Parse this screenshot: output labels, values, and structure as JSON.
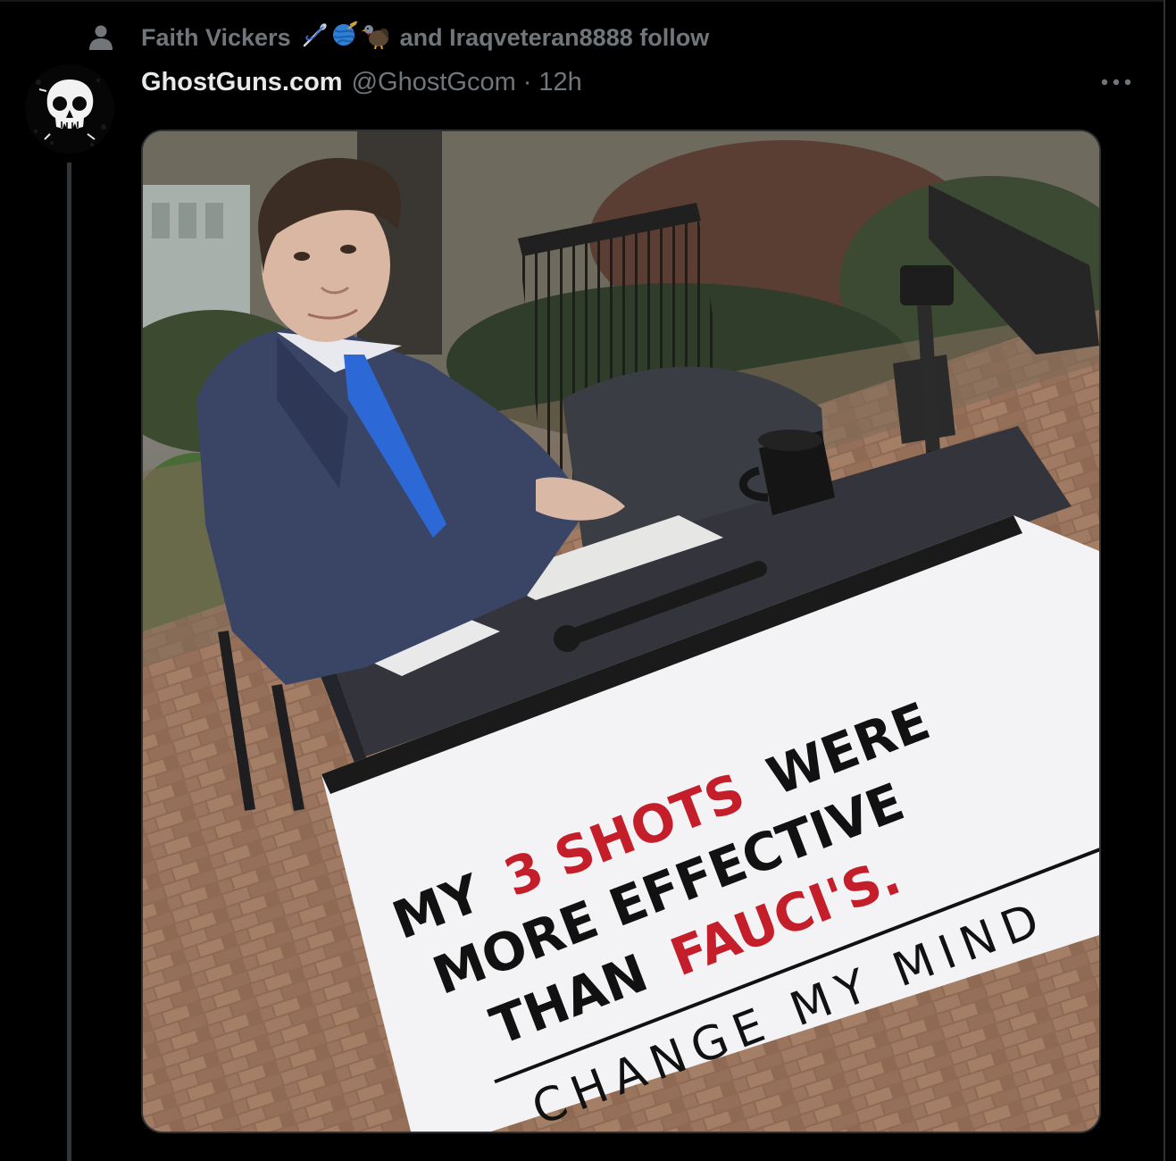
{
  "context": {
    "icon": "person-icon",
    "user_name": "Faith Vickers",
    "emojis": [
      "sewing-needle-icon",
      "yarn-ball-icon",
      "turkey-icon"
    ],
    "suffix": "and Iraqveteran8888 follow"
  },
  "tweet": {
    "author_name": "GhostGuns.com",
    "handle": "@GhostGcom",
    "separator": "·",
    "time": "12h",
    "more_icon": "more-horizontal-icon",
    "avatar_icon": "skull-icon"
  },
  "media": {
    "sign": {
      "line1_a": "MY",
      "line1_b": "3 SHOTS",
      "line1_c": "WERE",
      "line2": "MORE EFFECTIVE",
      "line3_a": "THAN",
      "line3_b": "FAUCI'S.",
      "footer": "CHANGE MY MIND"
    },
    "colors": {
      "sign_red": "#c41e2a",
      "sign_black": "#111111",
      "background": "#000000",
      "muted_text": "#71767b",
      "primary_text": "#e7e9ea"
    }
  }
}
